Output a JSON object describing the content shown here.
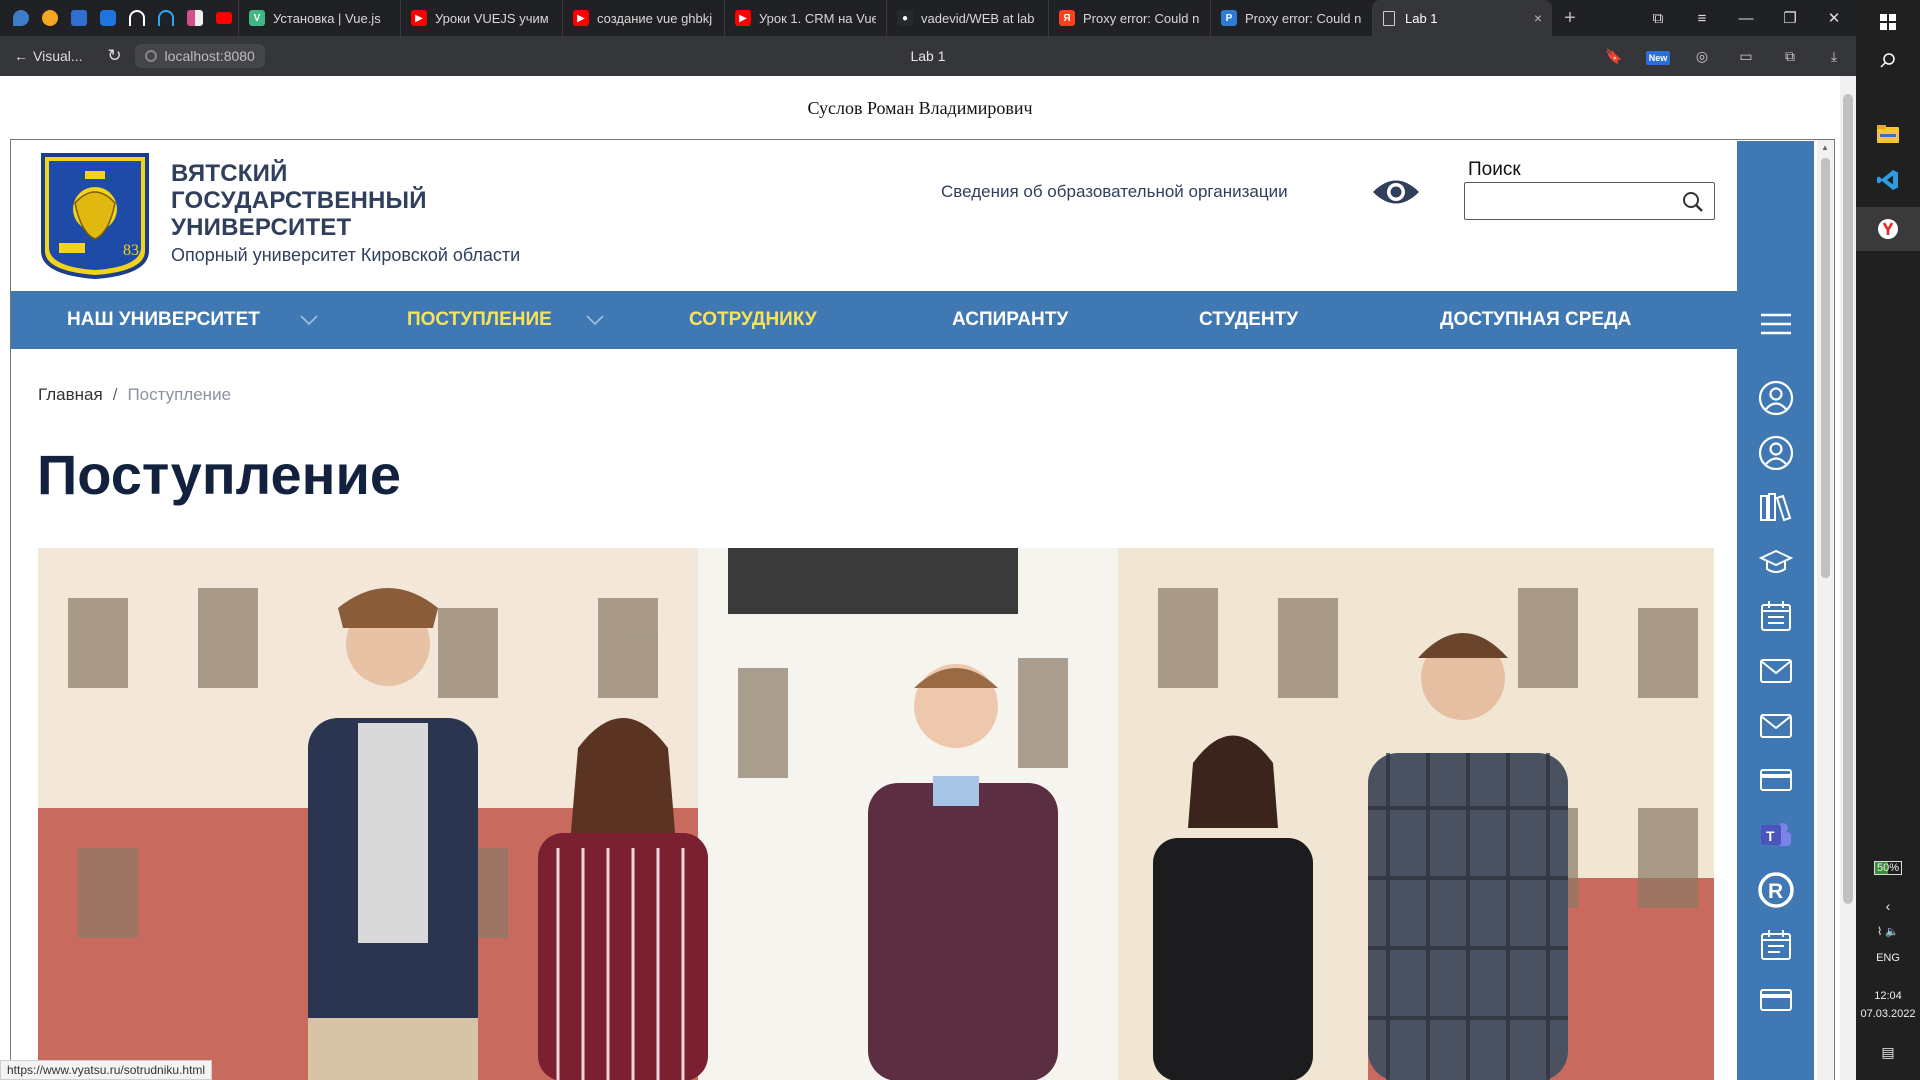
{
  "browser": {
    "pinned_tabs": [
      {
        "icon": "pin-icon-1",
        "color": "#3d7cc9"
      },
      {
        "icon": "pin-icon-2",
        "color": "#f5a623"
      },
      {
        "icon": "pin-icon-3",
        "color": "#2f6fd0"
      },
      {
        "icon": "pin-icon-4",
        "color": "#1f74e0"
      },
      {
        "icon": "headphones-icon",
        "color": "#ffffff"
      },
      {
        "icon": "headphones-blue-icon",
        "color": "#2aa7f7"
      },
      {
        "icon": "pin-icon-7",
        "color": "#d64f8c"
      },
      {
        "icon": "youtube-icon",
        "color": "#ff0000"
      }
    ],
    "tabs": [
      {
        "title": "Установка | Vue.js",
        "fav": "V",
        "color": "#41b883"
      },
      {
        "title": "Уроки VUEJS учим",
        "fav": "▶",
        "color": "#ff0000"
      },
      {
        "title": "создание vue ghbkj",
        "fav": "▶",
        "color": "#ff0000"
      },
      {
        "title": "Урок 1. CRM на Vue",
        "fav": "▶",
        "color": "#ff0000"
      },
      {
        "title": "vadevid/WEB at lab",
        "fav": "●",
        "color": "#24292e"
      },
      {
        "title": "Proxy error: Could n",
        "fav": "Я",
        "color": "#fc3f1d"
      },
      {
        "title": "Proxy error: Could n",
        "fav": "P",
        "color": "#2e7bd6"
      }
    ],
    "active_tab": {
      "title": "Lab 1",
      "close": "×"
    },
    "new_tab": "+",
    "back_label": "Visual...",
    "url": "localhost:8080",
    "page_title": "Lab 1",
    "status_url": "https://www.vyatsu.ru/sotrudniku.html"
  },
  "page": {
    "author": "Суслов Роман Владимирович"
  },
  "site": {
    "uni_name_lines": [
      "ВЯТСКИЙ",
      "ГОСУДАРСТВЕННЫЙ",
      "УНИВЕРСИТЕТ"
    ],
    "uni_sub": "Опорный университет Кировской области",
    "info_link": "Сведения об образовательной организации",
    "search_label": "Поиск",
    "nav": [
      {
        "label": "НАШ УНИВЕРСИТЕТ",
        "dropdown": true,
        "highlight": false
      },
      {
        "label": "ПОСТУПЛЕНИЕ",
        "dropdown": true,
        "highlight": true
      },
      {
        "label": "СОТРУДНИКУ",
        "dropdown": false,
        "highlight": true
      },
      {
        "label": "АСПИРАНТУ",
        "dropdown": false,
        "highlight": false
      },
      {
        "label": "СТУДЕНТУ",
        "dropdown": false,
        "highlight": false
      },
      {
        "label": "ДОСТУПНАЯ СРЕДА",
        "dropdown": false,
        "highlight": false
      }
    ],
    "breadcrumbs": {
      "home": "Главная",
      "sep": "/",
      "current": "Поступление"
    },
    "heading": "Поступление",
    "sidebar_icons": [
      "menu-icon",
      "user-circle-icon",
      "user-circle-icon",
      "library-icon",
      "graduation-cap-icon",
      "calendar-icon",
      "mail-icon",
      "mail-icon",
      "card-icon",
      "teams-icon",
      "registered-icon",
      "schedule-icon",
      "card-icon"
    ],
    "colors": {
      "brand_blue": "#3f78b2",
      "highlight_yellow": "#f7e35a",
      "dark_navy": "#12223e"
    }
  },
  "taskbar": {
    "battery": "50%",
    "lang": "ENG",
    "time": "12:04",
    "date": "07.03.2022"
  }
}
